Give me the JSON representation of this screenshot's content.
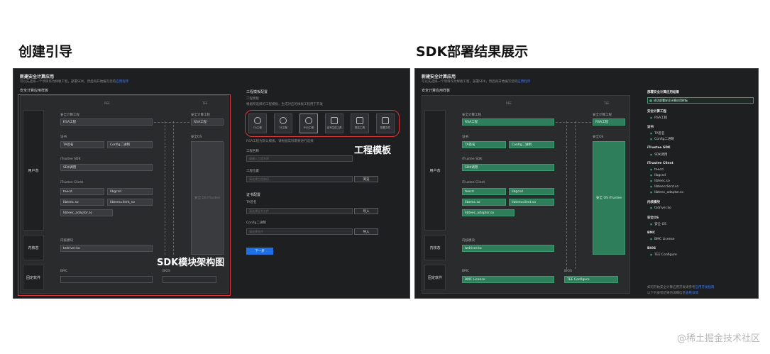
{
  "headings": {
    "left": "创建引导",
    "right": "SDK部署结果展示"
  },
  "watermark": "@稀土掘金技术社区",
  "left": {
    "title": "新建安全计算应用",
    "desc": "可以先选择一个项目作为样板工程，部署SDK，然后再开始编写您的",
    "desc_link": "应用程序",
    "section": "安全计算应用样板",
    "col_ree": "REE",
    "col_tee": "TEE",
    "row_user": "用户态",
    "row_kernel": "内核态",
    "row_fw": "固定软件",
    "ca_label": "安全计算工程",
    "ca_value": "RSA工程",
    "cert_label": "证书",
    "cert_a": "TA签名",
    "cert_b": "Config二进制",
    "sdk_label": "iTrustee SDK",
    "sdk_value": "SDK调用",
    "client_label": "iTrustee Client",
    "client_items": [
      "teecd",
      "libgcsd",
      "libteec.so",
      "libteecclient_so",
      "libteec_adaptor.so"
    ],
    "kernel_label": "内核模块",
    "kernel_value": "tzdriver.ko",
    "bmc_label": "BMC",
    "bios_label": "BIOS",
    "ta_label": "安全计算工程",
    "ta_value": "RSA工程",
    "tee_os_label": "安全OS",
    "tee_os_value": "安全 OS iTrustee",
    "template_title": "工程模板配置",
    "template_sub": "工程模板",
    "template_desc": "根据所选择的工程模板，生成对应的样板工程用于开发",
    "templates": [
      "CA工程",
      "TA工程",
      "RSA工程",
      "证书生成工具",
      "签名工具",
      "配置文件"
    ],
    "template_note": "RSA工程为默认模板，请根据实际需要进行选择",
    "proj_name_label": "工程名称",
    "proj_name_ph": "请输入工程名称",
    "proj_path_label": "工程位置",
    "proj_path_ph": "请选择工程路径",
    "browse": "浏览",
    "cert_cfg_title": "证书配置",
    "ta_cert_label": "TA签名",
    "ta_cert_ph": "请选择证书文件",
    "import1": "导入",
    "cfg_bin_label": "Config二进制",
    "cfg_bin_ph": "请选择文件",
    "import2": "导入",
    "next": "下一步",
    "anno_template": "工程模板",
    "anno_sdk": "SDK模块架构图"
  },
  "right": {
    "title": "新建安全计算应用",
    "desc": "可以先选择一个项目作为样板工程，部署SDK，然后再开始编写您的",
    "desc_link": "应用程序",
    "section": "安全计算应用样板",
    "col_ree": "REE",
    "col_tee": "TEE",
    "row_user": "用户态",
    "row_kernel": "内核态",
    "row_fw": "固定软件",
    "ca_label": "安全计算工程",
    "ca_value": "RSA工程",
    "cert_label": "证书",
    "cert_a": "TA签名",
    "cert_b": "Config二进制",
    "sdk_label": "iTrustee SDK",
    "sdk_value": "SDK调用",
    "client_label": "iTrustee Client",
    "client_items": [
      "teecd",
      "libgcsd",
      "libteec.so",
      "libteecclient.so",
      "libteec_adaptor.so"
    ],
    "kernel_label": "内核模块",
    "kernel_value": "tzdriver.ko",
    "bmc_label": "BMC",
    "bmc_value": "BMC License",
    "bios_label": "BIOS",
    "bios_value": "TEE Configure",
    "ta_label": "安全计算工程",
    "ta_value": "RSA工程",
    "tee_os_label": "安全OS",
    "tee_os_value": "安全 OS iTrustee",
    "side_title": "部署安全计算应用结果",
    "side_ok": "成功部署安全计算应用样板",
    "side": [
      {
        "t": "安全计算工程",
        "items": [
          "RSA工程"
        ]
      },
      {
        "t": "证书",
        "items": [
          "TA签名",
          "Config二进制"
        ]
      },
      {
        "t": "iTrustee SDK",
        "items": [
          "SDK调用"
        ]
      },
      {
        "t": "iTrustee Client",
        "items": [
          "teecd",
          "libgcsd",
          "libteec.so",
          "libteecclient.so",
          "libteec_adaptor.so"
        ]
      },
      {
        "t": "内核模块",
        "items": [
          "tzdriver.ko"
        ]
      },
      {
        "t": "安全OS",
        "items": [
          "安全 OS"
        ]
      },
      {
        "t": "BMC",
        "items": [
          "BMC License"
        ]
      },
      {
        "t": "BIOS",
        "items": [
          "TEE Configure"
        ]
      }
    ],
    "side_foot1": "如何开始安全计算应用开发请参考",
    "side_foot1_link": "应用开发指南",
    "side_foot2": "以下为安装结果的详细信息",
    "side_foot2_link": "查看详情"
  },
  "colors": {
    "accent_red": "#d9363e",
    "green": "#2e7d5b",
    "link": "#3d7bff",
    "primary": "#1f6fe5"
  }
}
